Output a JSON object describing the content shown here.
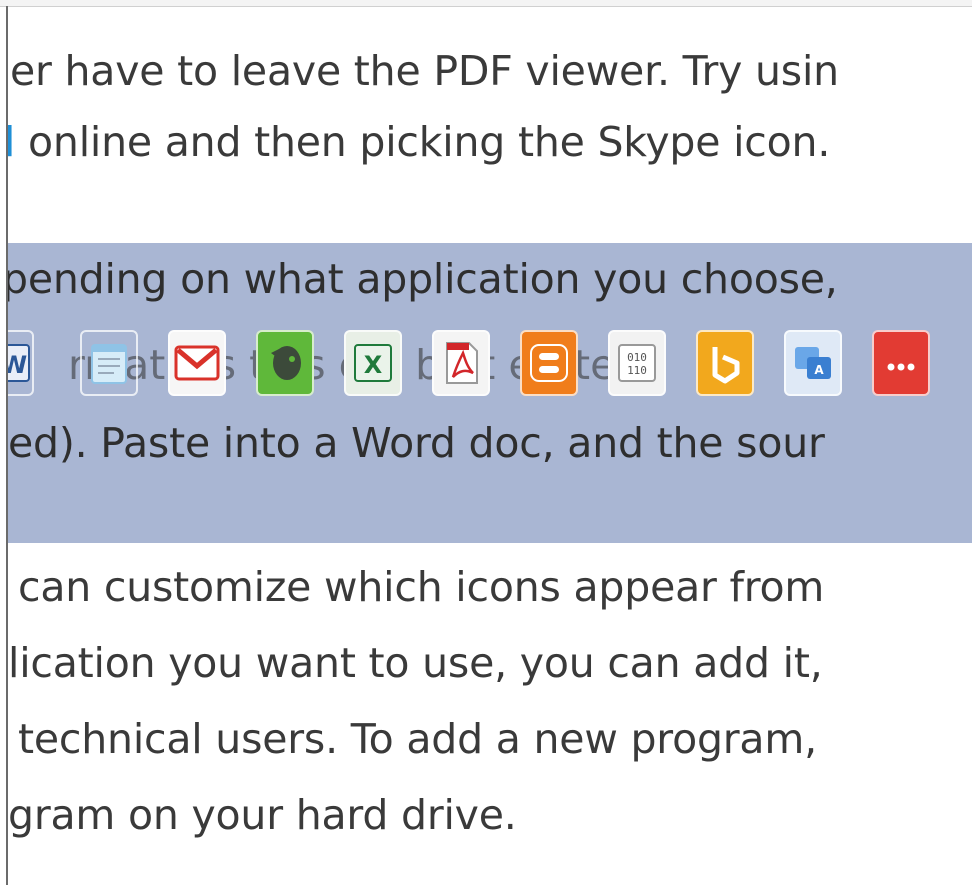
{
  "document": {
    "lines_top": [
      {
        "text": "er have to leave the PDF viewer. Try usin"
      },
      {
        "prefix": "l",
        "text": " online and then picking the Skype icon. "
      }
    ],
    "selected_lines": [
      {
        "text": "pending on what application you choose,"
      },
      {
        "text": "ed). Paste into a Word doc, and the sour"
      }
    ],
    "toolbar_ghost_text": "rmatio    s th   s   e a   bo  t  e   f   ter",
    "lines_bottom": [
      {
        "text": " can customize which icons appear from"
      },
      {
        "text": "lication you want to use, you can add it,"
      },
      {
        "text": " technical users. To add a new program,"
      },
      {
        "text": "gram on your hard drive."
      }
    ]
  },
  "toolbar": {
    "items": [
      {
        "name": "word-icon",
        "color": "#2b5797"
      },
      {
        "name": "notepad-icon",
        "color": "#8fc3e6"
      },
      {
        "name": "gmail-icon",
        "color": "#d9322a"
      },
      {
        "name": "evernote-icon",
        "color": "#5fb83a"
      },
      {
        "name": "excel-icon",
        "color": "#1f7a3b"
      },
      {
        "name": "pdf-icon",
        "color": "#d2262a"
      },
      {
        "name": "blogger-icon",
        "color": "#f07d1b"
      },
      {
        "name": "binary-icon",
        "color": "#7a7a7a"
      },
      {
        "name": "bing-icon",
        "color": "#f2a81d"
      },
      {
        "name": "translate-icon",
        "color": "#3a7fd1"
      },
      {
        "name": "more-icon",
        "color": "#e23b33"
      }
    ]
  }
}
